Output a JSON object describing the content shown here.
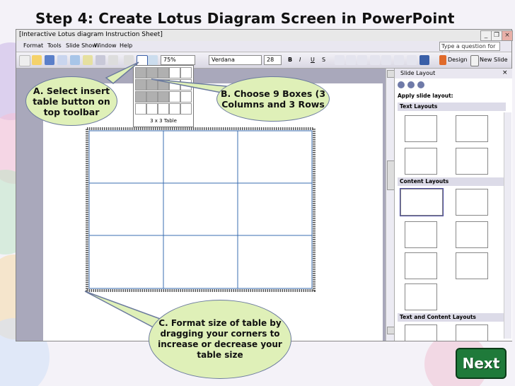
{
  "title": "Step 4:  Create Lotus Diagram Screen in PowerPoint",
  "window": {
    "title": "[Interactive Lotus diagram Instruction Sheet]",
    "menu": [
      "Format",
      "Tools",
      "Slide Show",
      "Window",
      "Help"
    ],
    "ask_placeholder": "Type a question for help",
    "zoom": "75%",
    "font_name": "Verdana",
    "font_size": "28",
    "design_label": "Design",
    "new_slide_label": "New Slide"
  },
  "table_picker": {
    "label": "3 x 3 Table",
    "rows": 4,
    "cols": 5,
    "selected_rows": 3,
    "selected_cols": 3
  },
  "task_pane": {
    "title": "Slide Layout",
    "apply_label": "Apply slide layout:",
    "sections": [
      "Text Layouts",
      "Content Layouts",
      "Text and Content Layouts"
    ]
  },
  "callouts": {
    "a": "A.  Select insert table button on top toolbar",
    "b": "B.  Choose 9 Boxes (3 Columns and 3 Rows",
    "c": "C.  Format size of table by dragging your corners to increase or decrease your table size"
  },
  "next_button": "Next",
  "colors": {
    "callout_fill": "#dff0b8",
    "table_line": "#3a6cb0",
    "next_bg": "#1f7a3a"
  }
}
